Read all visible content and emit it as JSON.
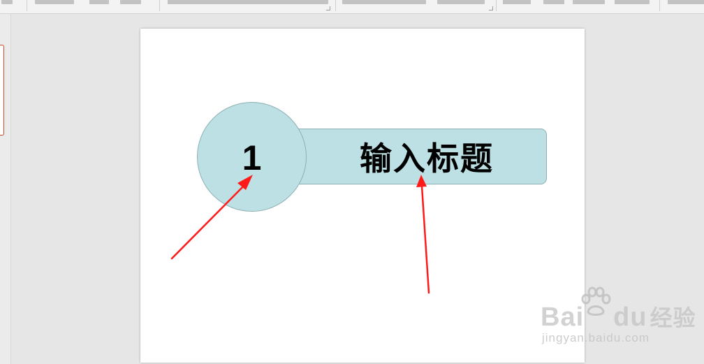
{
  "slide": {
    "circle_number": "1",
    "title_placeholder": "输入标题"
  },
  "colors": {
    "shape_fill": "#bde0e4",
    "shape_border": "#8db0b5",
    "arrow": "#ff1a1a",
    "thumbnail_selected_border": "#d24726",
    "workspace_background": "#e6e6e6"
  },
  "watermark": {
    "brand": "Bai",
    "brand_tail": "du",
    "product": "经验",
    "url": "jingyan.baidu.com"
  }
}
